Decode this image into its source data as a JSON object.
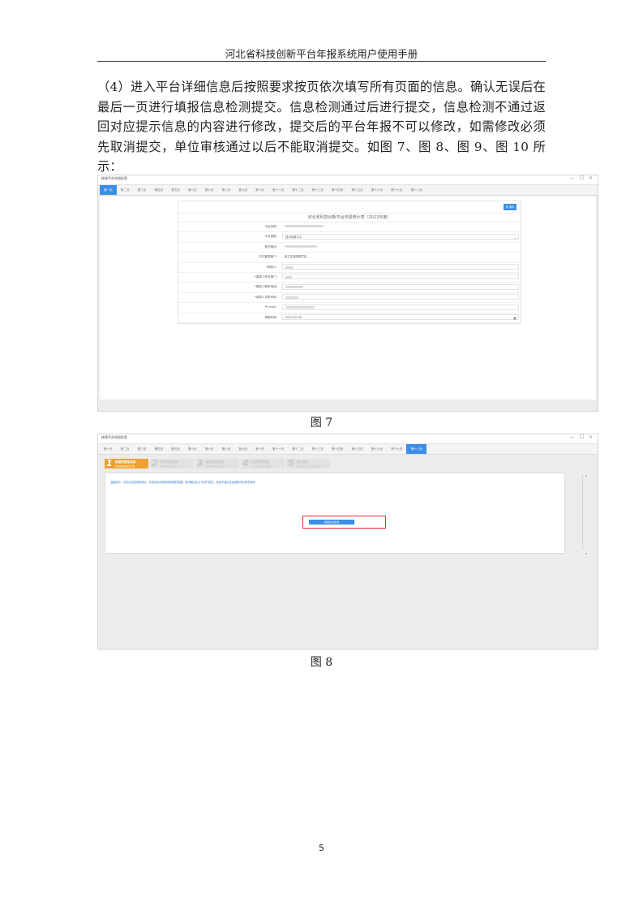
{
  "header": {
    "title": "河北省科技创新平台年报系统用户使用手册"
  },
  "paragraph": "（4）进入平台详细信息后按照要求按页依次填写所有页面的信息。确认无误后在最后一页进行填报信息检测提交。信息检测通过后进行提交，信息检测不通过返回对应提示信息的内容进行修改，提交后的平台年报不可以修改，如需修改必须先取消提交，单位审核通过以后不能取消提交。如图 7、图 8、图 9、图 10 所示：",
  "figure7": {
    "caption": "图 7",
    "window_title": "修改平台年报信息",
    "window_controls": "— ☐ ×",
    "tabs": [
      "第一页",
      "第二页",
      "第三页",
      "第四页",
      "第五页",
      "第六页",
      "第七页",
      "第八页",
      "第九页",
      "第十页",
      "第十一页",
      "第十二页",
      "第十三页",
      "第十四页",
      "第十五页",
      "第十六页",
      "第十七页",
      "第十八页"
    ],
    "active_tab": 0,
    "save_label": "暂 保存",
    "form_title": "河北省科技创新平台年报统计表（2022年度）",
    "fields": [
      {
        "label": "平台名称:",
        "value": "",
        "kind": "plain",
        "blur": 48
      },
      {
        "label": "平台类型:",
        "value": "技术创新中心",
        "kind": "select"
      },
      {
        "label": "依托单位:",
        "value": "",
        "kind": "plain",
        "blur": 40
      },
      {
        "label": "归口管理部门:",
        "value": "省卫生健康委员会",
        "kind": "plain"
      },
      {
        "label": "*填表人:",
        "value": "",
        "kind": "input",
        "blur": 10
      },
      {
        "label": "*填表人所在部门:",
        "value": "",
        "kind": "input",
        "blur": 8
      },
      {
        "label": "*填表人联系电话:",
        "value": "",
        "kind": "input",
        "blur": 22
      },
      {
        "label": "*填表人手机号码:",
        "value": "",
        "kind": "input",
        "blur": 16
      },
      {
        "label": "*E-mail :",
        "value": "",
        "kind": "input",
        "blur": 36
      },
      {
        "label": "填报时间:",
        "value": "2023-02-06",
        "kind": "date"
      }
    ],
    "calendar_icon": "▦",
    "select_arrow": "⌄"
  },
  "figure8": {
    "caption": "图 8",
    "window_title": "修改平台年报信息",
    "window_controls": "— ☐ ×",
    "tabs": [
      "第一页",
      "第二页",
      "第三页",
      "第四页",
      "第五页",
      "第六页",
      "第七页",
      "第八页",
      "第九页",
      "第十页",
      "第十一页",
      "第十二页",
      "第十三页",
      "第十四页",
      "第十五页",
      "第十六页",
      "第十七页",
      "第十八页"
    ],
    "active_tab": 17,
    "steps": [
      {
        "num": "1",
        "label": "数据完整性检测",
        "sub": "检测填报数据是否完整"
      },
      {
        "num": "2",
        "label": "附件信息检测",
        "sub": "检测附件信息是否上传"
      },
      {
        "num": "3",
        "label": "填报信息检测",
        "sub": "检测填报信息是否正确"
      },
      {
        "num": "4",
        "label": "生成年报数据",
        "sub": "生成平台年报统计数据"
      },
      {
        "num": "5",
        "label": "确认提交",
        "sub": "确认无误后，提交年报信息"
      }
    ],
    "notice": "温馨提示：点击信息检测按钮后，系统将自动检测您填报的数据，检测通过后方可进行提交，检测不通过请返回修改后再次检测",
    "check_button": "填报信息检测",
    "scroll_up": "▴",
    "scroll_down": "▾"
  },
  "page_number": "5"
}
